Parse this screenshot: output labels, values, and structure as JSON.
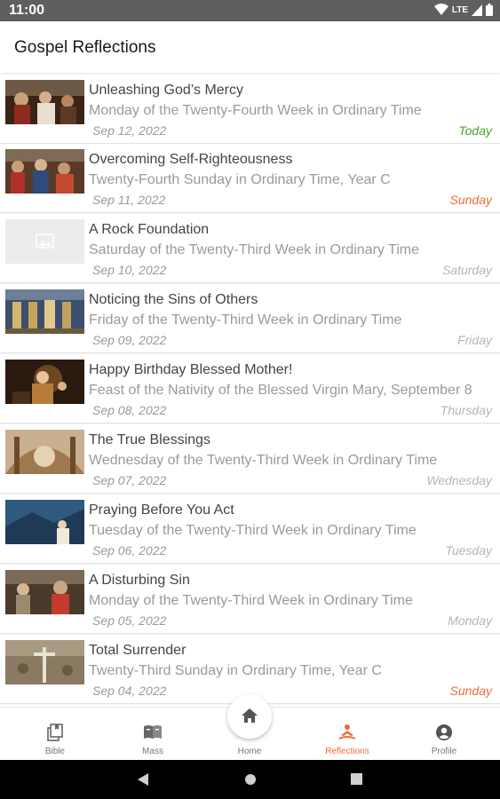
{
  "status_bar": {
    "time": "11:00",
    "network": "LTE"
  },
  "app_bar": {
    "title": "Gospel Reflections"
  },
  "colors": {
    "accent": "#f26b38",
    "today": "#45a22e",
    "sunday": "#f26b38",
    "weekday": "#b5b5b5"
  },
  "reflections": [
    {
      "title": "Unleashing God’s Mercy",
      "subtitle": "Monday of the Twenty-Fourth Week in Ordinary Time",
      "date": "Sep 12, 2022",
      "day": "Today",
      "day_color": "#45a22e",
      "thumb": "painting-crowd"
    },
    {
      "title": "Overcoming Self-Righteousness",
      "subtitle": "Twenty-Fourth Sunday in Ordinary Time, Year C",
      "date": "Sep 11, 2022",
      "day": "Sunday",
      "day_color": "#f26b38",
      "thumb": "painting-figures"
    },
    {
      "title": "A Rock Foundation",
      "subtitle": "Saturday of the Twenty-Third Week in Ordinary Time",
      "date": "Sep 10, 2022",
      "day": "Saturday",
      "day_color": "#b5b5b5",
      "thumb": "image-placeholder"
    },
    {
      "title": "Noticing the Sins of Others",
      "subtitle": "Friday of the Twenty-Third Week in Ordinary Time",
      "date": "Sep 09, 2022",
      "day": "Friday",
      "day_color": "#b5b5b5",
      "thumb": "painting-mosaic"
    },
    {
      "title": "Happy Birthday Blessed Mother!",
      "subtitle": "Feast of the Nativity of the Blessed Virgin Mary, September 8",
      "date": "Sep 08, 2022",
      "day": "Thursday",
      "day_color": "#b5b5b5",
      "thumb": "painting-nativity"
    },
    {
      "title": "The True Blessings",
      "subtitle": "Wednesday of the Twenty-Third Week in Ordinary Time",
      "date": "Sep 07, 2022",
      "day": "Wednesday",
      "day_color": "#b5b5b5",
      "thumb": "painting-dome"
    },
    {
      "title": "Praying Before You Act",
      "subtitle": "Tuesday of the Twenty-Third Week in Ordinary Time",
      "date": "Sep 06, 2022",
      "day": "Tuesday",
      "day_color": "#b5b5b5",
      "thumb": "painting-mountain"
    },
    {
      "title": "A Disturbing Sin",
      "subtitle": "Monday of the Twenty-Third Week in Ordinary Time",
      "date": "Sep 05, 2022",
      "day": "Monday",
      "day_color": "#b5b5b5",
      "thumb": "painting-jesus"
    },
    {
      "title": "Total Surrender",
      "subtitle": "Twenty-Third Sunday in Ordinary Time, Year C",
      "date": "Sep 04, 2022",
      "day": "Sunday",
      "day_color": "#f26b38",
      "thumb": "painting-cross"
    }
  ],
  "bottom_nav": {
    "items": [
      {
        "label": "Bible",
        "icon": "bible-icon",
        "active": false
      },
      {
        "label": "Mass",
        "icon": "mass-book-icon",
        "active": false
      },
      {
        "label": "Home",
        "icon": "home-icon",
        "active": false
      },
      {
        "label": "Reflections",
        "icon": "reflections-icon",
        "active": true
      },
      {
        "label": "Profile",
        "icon": "profile-icon",
        "active": false
      }
    ]
  }
}
